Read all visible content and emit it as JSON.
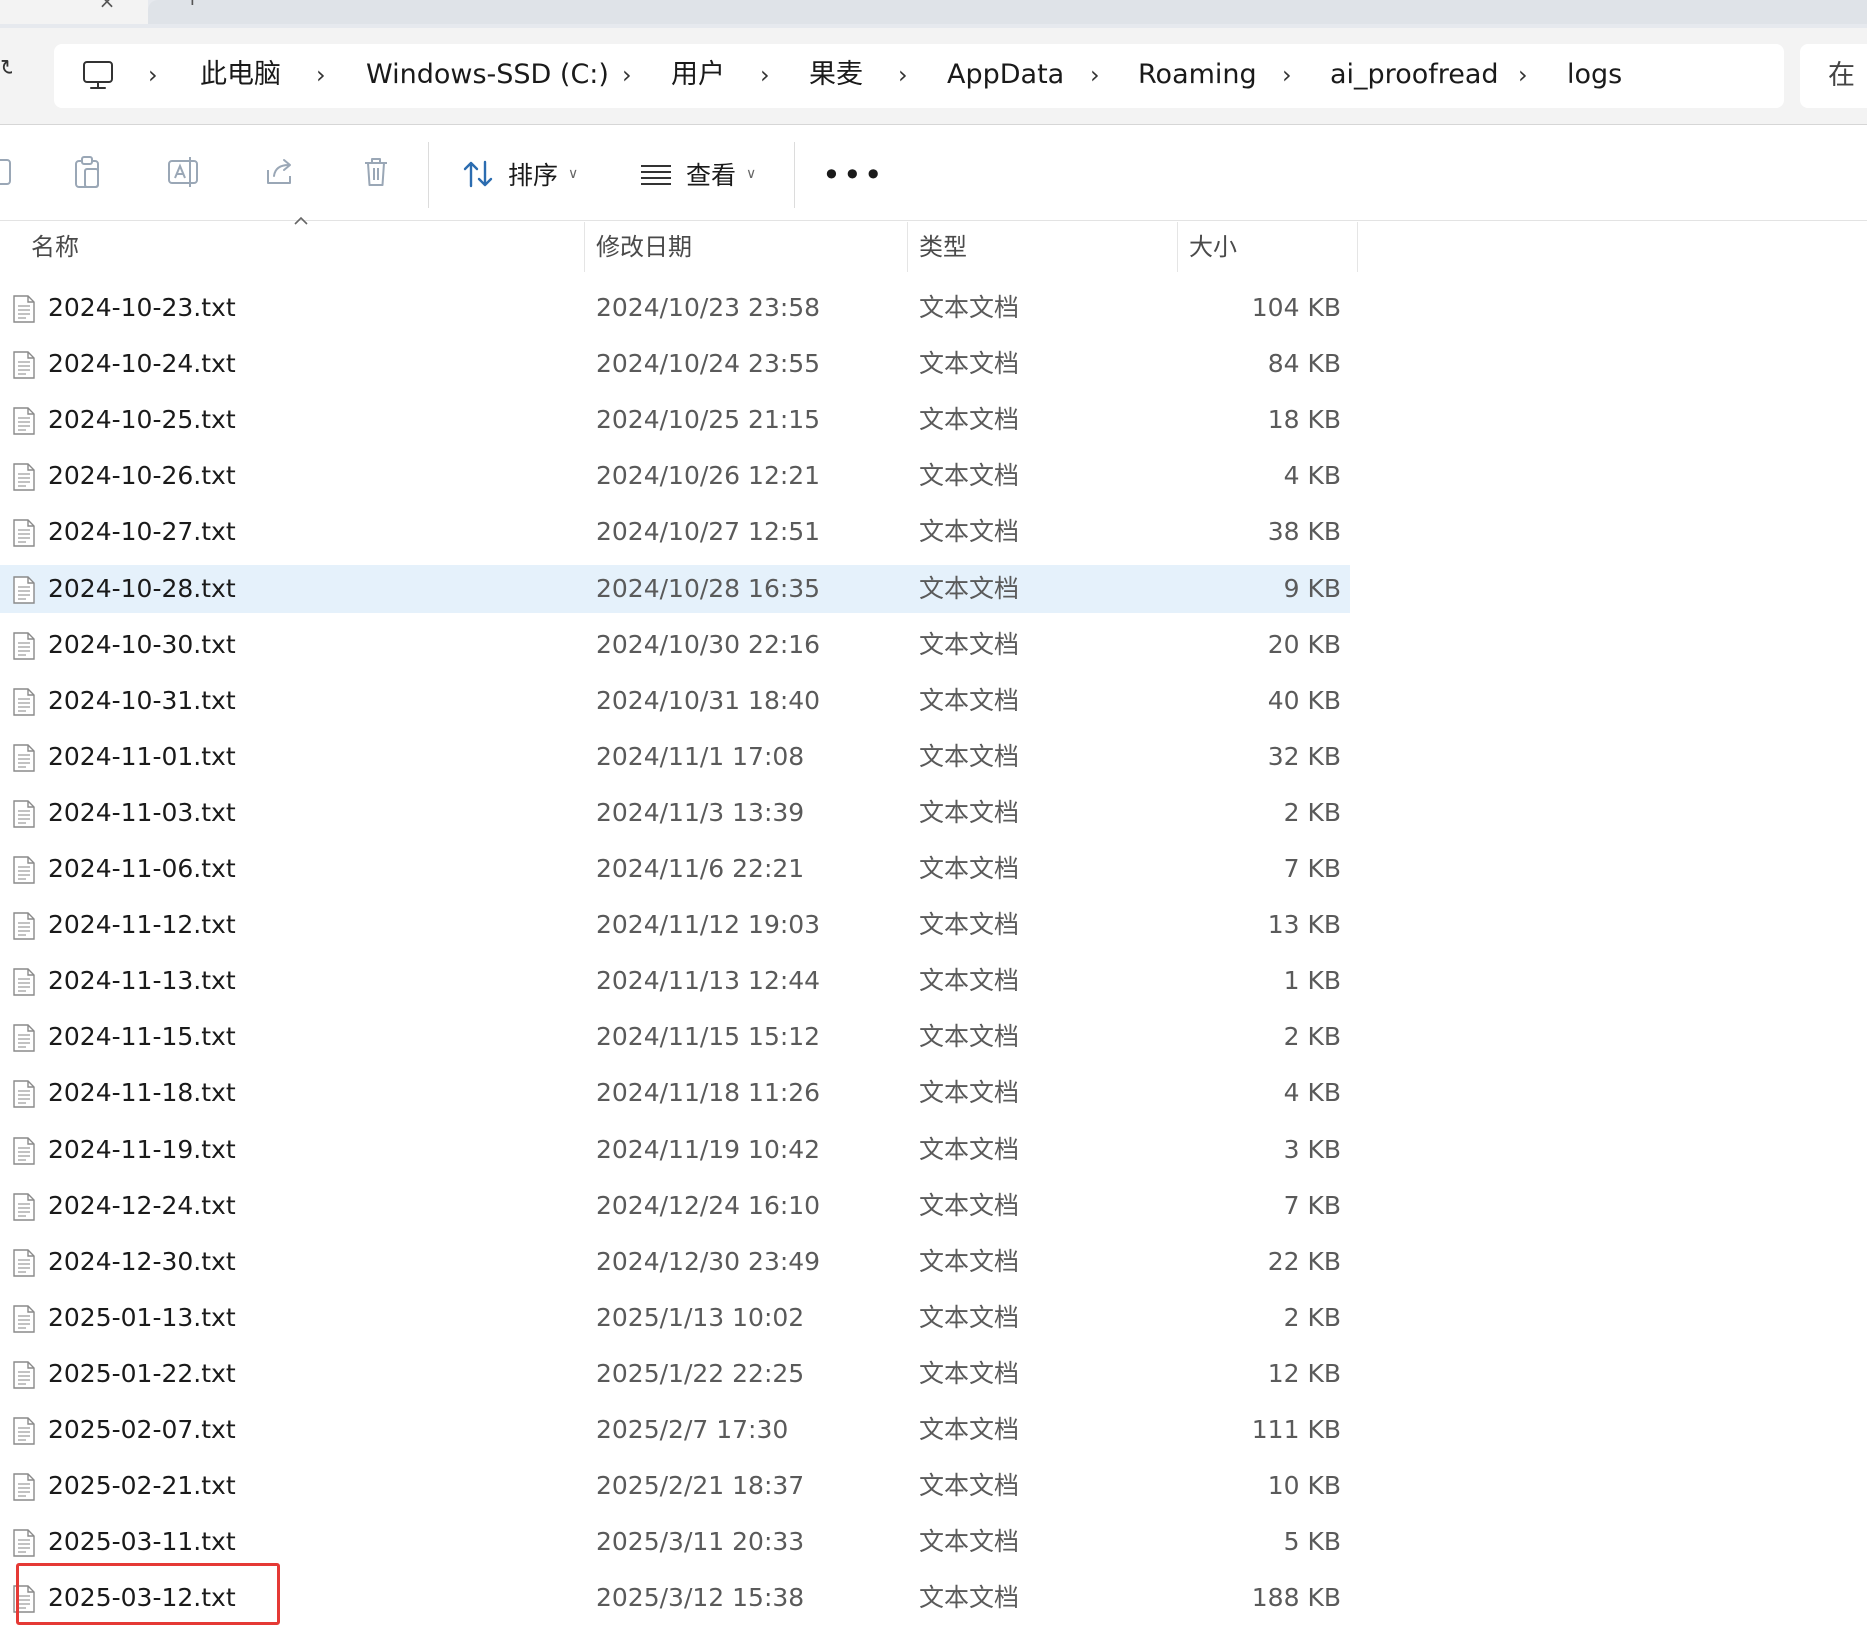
{
  "address_bar": {
    "crumbs": [
      "此电脑",
      "Windows-SSD (C:)",
      "用户",
      "果麦",
      "AppData",
      "Roaming",
      "ai_proofread",
      "logs"
    ],
    "search_label": "在"
  },
  "toolbar": {
    "sort_label": "排序",
    "view_label": "查看",
    "more_label": "•••"
  },
  "columns": {
    "name": "名称",
    "date": "修改日期",
    "type": "类型",
    "size": "大小"
  },
  "files": [
    {
      "name": "2024-10-23.txt",
      "date": "2024/10/23 23:58",
      "type": "文本文档",
      "size": "104 KB"
    },
    {
      "name": "2024-10-24.txt",
      "date": "2024/10/24 23:55",
      "type": "文本文档",
      "size": "84 KB"
    },
    {
      "name": "2024-10-25.txt",
      "date": "2024/10/25 21:15",
      "type": "文本文档",
      "size": "18 KB"
    },
    {
      "name": "2024-10-26.txt",
      "date": "2024/10/26 12:21",
      "type": "文本文档",
      "size": "4 KB"
    },
    {
      "name": "2024-10-27.txt",
      "date": "2024/10/27 12:51",
      "type": "文本文档",
      "size": "38 KB"
    },
    {
      "name": "2024-10-28.txt",
      "date": "2024/10/28 16:35",
      "type": "文本文档",
      "size": "9 KB",
      "selected": true
    },
    {
      "name": "2024-10-30.txt",
      "date": "2024/10/30 22:16",
      "type": "文本文档",
      "size": "20 KB"
    },
    {
      "name": "2024-10-31.txt",
      "date": "2024/10/31 18:40",
      "type": "文本文档",
      "size": "40 KB"
    },
    {
      "name": "2024-11-01.txt",
      "date": "2024/11/1 17:08",
      "type": "文本文档",
      "size": "32 KB"
    },
    {
      "name": "2024-11-03.txt",
      "date": "2024/11/3 13:39",
      "type": "文本文档",
      "size": "2 KB"
    },
    {
      "name": "2024-11-06.txt",
      "date": "2024/11/6 22:21",
      "type": "文本文档",
      "size": "7 KB"
    },
    {
      "name": "2024-11-12.txt",
      "date": "2024/11/12 19:03",
      "type": "文本文档",
      "size": "13 KB"
    },
    {
      "name": "2024-11-13.txt",
      "date": "2024/11/13 12:44",
      "type": "文本文档",
      "size": "1 KB"
    },
    {
      "name": "2024-11-15.txt",
      "date": "2024/11/15 15:12",
      "type": "文本文档",
      "size": "2 KB"
    },
    {
      "name": "2024-11-18.txt",
      "date": "2024/11/18 11:26",
      "type": "文本文档",
      "size": "4 KB"
    },
    {
      "name": "2024-11-19.txt",
      "date": "2024/11/19 10:42",
      "type": "文本文档",
      "size": "3 KB"
    },
    {
      "name": "2024-12-24.txt",
      "date": "2024/12/24 16:10",
      "type": "文本文档",
      "size": "7 KB"
    },
    {
      "name": "2024-12-30.txt",
      "date": "2024/12/30 23:49",
      "type": "文本文档",
      "size": "22 KB"
    },
    {
      "name": "2025-01-13.txt",
      "date": "2025/1/13 10:02",
      "type": "文本文档",
      "size": "2 KB"
    },
    {
      "name": "2025-01-22.txt",
      "date": "2025/1/22 22:25",
      "type": "文本文档",
      "size": "12 KB"
    },
    {
      "name": "2025-02-07.txt",
      "date": "2025/2/7 17:30",
      "type": "文本文档",
      "size": "111 KB"
    },
    {
      "name": "2025-02-21.txt",
      "date": "2025/2/21 18:37",
      "type": "文本文档",
      "size": "10 KB"
    },
    {
      "name": "2025-03-11.txt",
      "date": "2025/3/11 20:33",
      "type": "文本文档",
      "size": "5 KB"
    },
    {
      "name": "2025-03-12.txt",
      "date": "2025/3/12 15:38",
      "type": "文本文档",
      "size": "188 KB",
      "highlighted": true
    }
  ],
  "colors": {
    "selected_row": "#e5f1fb",
    "highlight_box": "#e53935",
    "chrome_bg": "#f3f3f3"
  },
  "icons": {
    "breadcrumb_root": "computer-icon",
    "file": "text-file-icon"
  }
}
